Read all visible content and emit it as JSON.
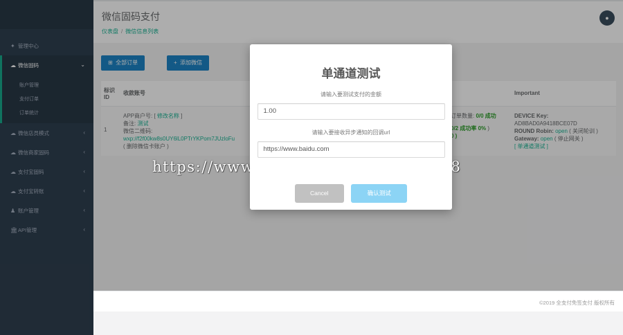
{
  "sidebar": {
    "items": [
      {
        "icon": "home-icon",
        "glyph": "✦",
        "label": "管理中心",
        "has_arrow": false
      },
      {
        "icon": "cloud-icon",
        "glyph": "☁",
        "label": "微信固码",
        "has_arrow": true,
        "arrow": "⌄",
        "active": true,
        "sub": [
          "账户管理",
          "支付订单",
          "订单统计"
        ]
      },
      {
        "icon": "cloud-icon",
        "glyph": "☁",
        "label": "微信店员模式",
        "has_arrow": true,
        "arrow": "‹"
      },
      {
        "icon": "cloud-icon",
        "glyph": "☁",
        "label": "微信商家固码",
        "has_arrow": true,
        "arrow": "‹"
      },
      {
        "icon": "cloud-icon",
        "glyph": "☁",
        "label": "支付宝固码",
        "has_arrow": true,
        "arrow": "‹"
      },
      {
        "icon": "cloud-icon",
        "glyph": "☁",
        "label": "支付宝转账",
        "has_arrow": true,
        "arrow": "‹"
      },
      {
        "icon": "user-icon",
        "glyph": "♟",
        "label": "账户管理",
        "has_arrow": true,
        "arrow": "‹"
      },
      {
        "icon": "bank-icon",
        "glyph": "🏛",
        "label": "API管理",
        "has_arrow": true,
        "arrow": "‹"
      }
    ]
  },
  "header": {
    "title": "微信固码支付",
    "breadcrumb": [
      "仪表盘",
      "/",
      "微信信息列表"
    ],
    "avatar_glyph": "●"
  },
  "toolbar": {
    "all_orders": "全部订单",
    "all_orders_icon": "⊞",
    "add_wechat": "添加微信",
    "add_icon": "+"
  },
  "table": {
    "headers": [
      "标识ID",
      "收款账号",
      "Important"
    ],
    "row": {
      "id": "1",
      "app_prefix": "APP商户号: [",
      "modify_name": "修改名称",
      "app_suffix": "]",
      "remark_prefix": "备注: ",
      "remark_value": "测试",
      "qr_label": "微信二维码:",
      "qr_value": "wxp://f2f00kw8s0UY6lL0PTrYKPom7JUzloFu",
      "delete_link": "( 删除微信卡账户 )",
      "stats_line1": "订单数量: ",
      "stats_count": "0/0 成功",
      "stats_line2": "0/2 成功率 0%",
      "stats_line2_suffix": " )",
      "stats_line3": "0 )",
      "device_key_label": "DEVICE Key:",
      "device_key": "AD8BAD0A9418BCE07D",
      "robin_label": "ROUND Robin: ",
      "robin_status": "open",
      "robin_action": "( 关闭轮训 )",
      "gateway_label": "Gateway: ",
      "gateway_status": "open",
      "gateway_action": "( 停止网关 )",
      "single_test": "[ 单通道测试 ]"
    }
  },
  "footer": {
    "text": "©2019 全支付免签支付 版权所有"
  },
  "watermark": "https://www.huzhan.com/ishop37148",
  "modal": {
    "title": "单通道测试",
    "amount_label": "请输入要测试支付的金额",
    "amount_value": "1.00",
    "url_label": "请输入要接收异步通知的回调url",
    "url_value": "https://www.baidu.com",
    "cancel": "Cancel",
    "confirm": "确认测试"
  },
  "colors": {
    "sidebar": "#2f4050",
    "accent": "#1ab394",
    "primary": "#1c84c6",
    "confirm": "#8cd4f5",
    "cancel": "#c1c1c1"
  }
}
